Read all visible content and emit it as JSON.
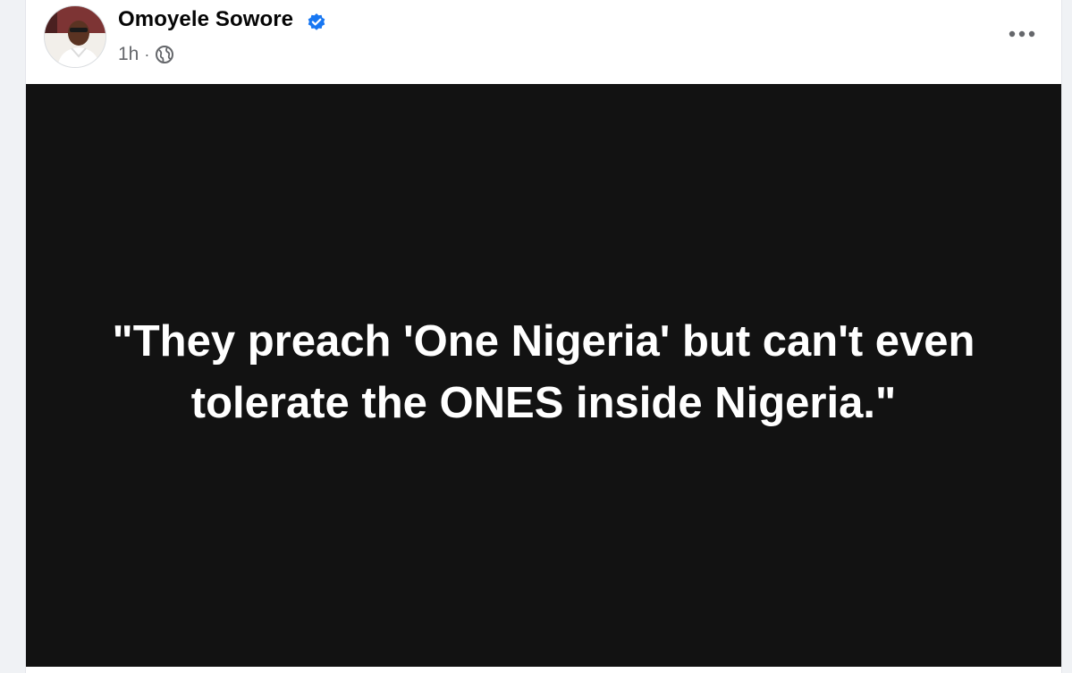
{
  "post": {
    "author": {
      "name": "Omoyele Sowore",
      "verified": true,
      "avatar_icon": "profile-photo"
    },
    "meta": {
      "time": "1h",
      "separator": "·",
      "audience_icon": "globe-icon"
    },
    "more_icon": "ellipsis-icon",
    "image_text": "\"They preach 'One Nigeria' but can't even tolerate the ONES inside Nigeria.\""
  },
  "colors": {
    "verified_blue": "#1877f2",
    "image_background": "#121212",
    "meta_gray": "#65676b",
    "feed_background": "#f0f2f5"
  }
}
